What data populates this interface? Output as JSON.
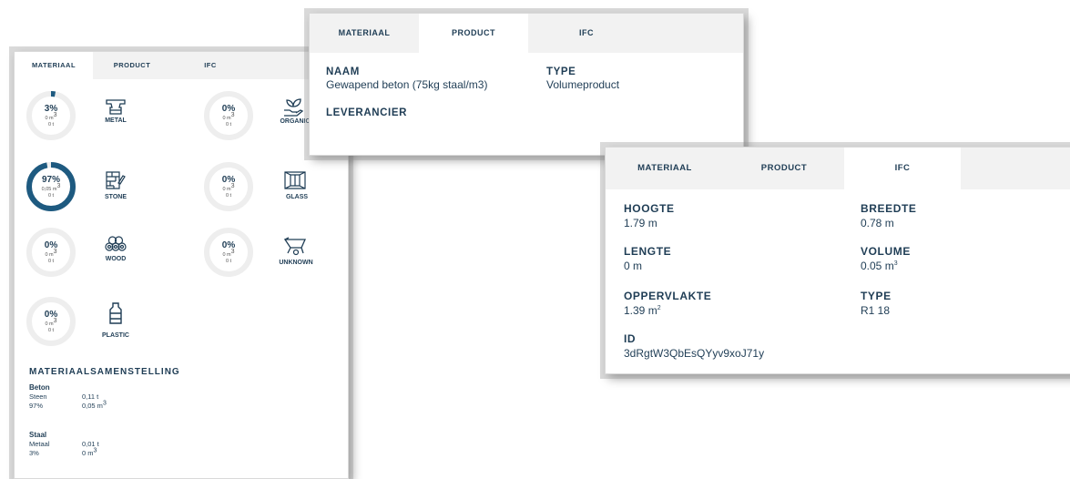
{
  "material_panel": {
    "tabs": [
      {
        "label": "MATERIAAL"
      },
      {
        "label": "PRODUCT"
      },
      {
        "label": "IFC"
      }
    ],
    "materials": [
      {
        "name": "METAL",
        "pct": "3%",
        "volume": "0 m",
        "weight": "0 t",
        "fill": 0.03,
        "icon": "anvil-icon"
      },
      {
        "name": "ORGANIC",
        "pct": "0%",
        "volume": "0 m",
        "weight": "0 t",
        "fill": 0,
        "icon": "plant-hand-icon"
      },
      {
        "name": "STONE",
        "pct": "97%",
        "volume": "0,05 m",
        "weight": "0 t",
        "fill": 0.97,
        "icon": "brick-wall-icon"
      },
      {
        "name": "GLASS",
        "pct": "0%",
        "volume": "0 m",
        "weight": "0 t",
        "fill": 0,
        "icon": "window-icon"
      },
      {
        "name": "WOOD",
        "pct": "0%",
        "volume": "0 m",
        "weight": "0 t",
        "fill": 0,
        "icon": "logs-icon"
      },
      {
        "name": "UNKNOWN",
        "pct": "0%",
        "volume": "0 m",
        "weight": "0 t",
        "fill": 0,
        "icon": "wheelbarrow-icon"
      },
      {
        "name": "PLASTIC",
        "pct": "0%",
        "volume": "0 m",
        "weight": "0 t",
        "fill": 0,
        "icon": "bottle-icon"
      }
    ],
    "composition_title": "MATERIAALSAMENSTELLING",
    "composition": [
      {
        "name": "Beton",
        "category": "Steen",
        "pct": "97%",
        "weight": "0,11 t",
        "volume": "0,05 m"
      },
      {
        "name": "Staal",
        "category": "Metaal",
        "pct": "3%",
        "weight": "0,01 t",
        "volume": "0 m"
      }
    ],
    "ring_color": "#1e5a80",
    "ring_track": "#eeeeee"
  },
  "product_panel": {
    "tabs": [
      {
        "label": "MATERIAAL"
      },
      {
        "label": "PRODUCT"
      },
      {
        "label": "IFC"
      }
    ],
    "naam_label": "NAAM",
    "naam_value": "Gewapend beton (75kg staal/m3)",
    "type_label": "TYPE",
    "type_value": "Volumeproduct",
    "leverancier_label": "LEVERANCIER"
  },
  "ifc_panel": {
    "tabs": [
      {
        "label": "MATERIAAL"
      },
      {
        "label": "PRODUCT"
      },
      {
        "label": "IFC"
      }
    ],
    "hoogte_label": "HOOGTE",
    "hoogte_value": "1.79 m",
    "breedte_label": "BREEDTE",
    "breedte_value": "0.78 m",
    "lengte_label": "LENGTE",
    "lengte_value": "0 m",
    "volume_label": "VOLUME",
    "volume_value": "0.05 m",
    "oppervlakte_label": "OPPERVLAKTE",
    "oppervlakte_value": "1.39 m",
    "type_label": "TYPE",
    "type_value": "R1 18",
    "id_label": "ID",
    "id_value": "3dRgtW3QbEsQYyv9xoJ71y"
  }
}
